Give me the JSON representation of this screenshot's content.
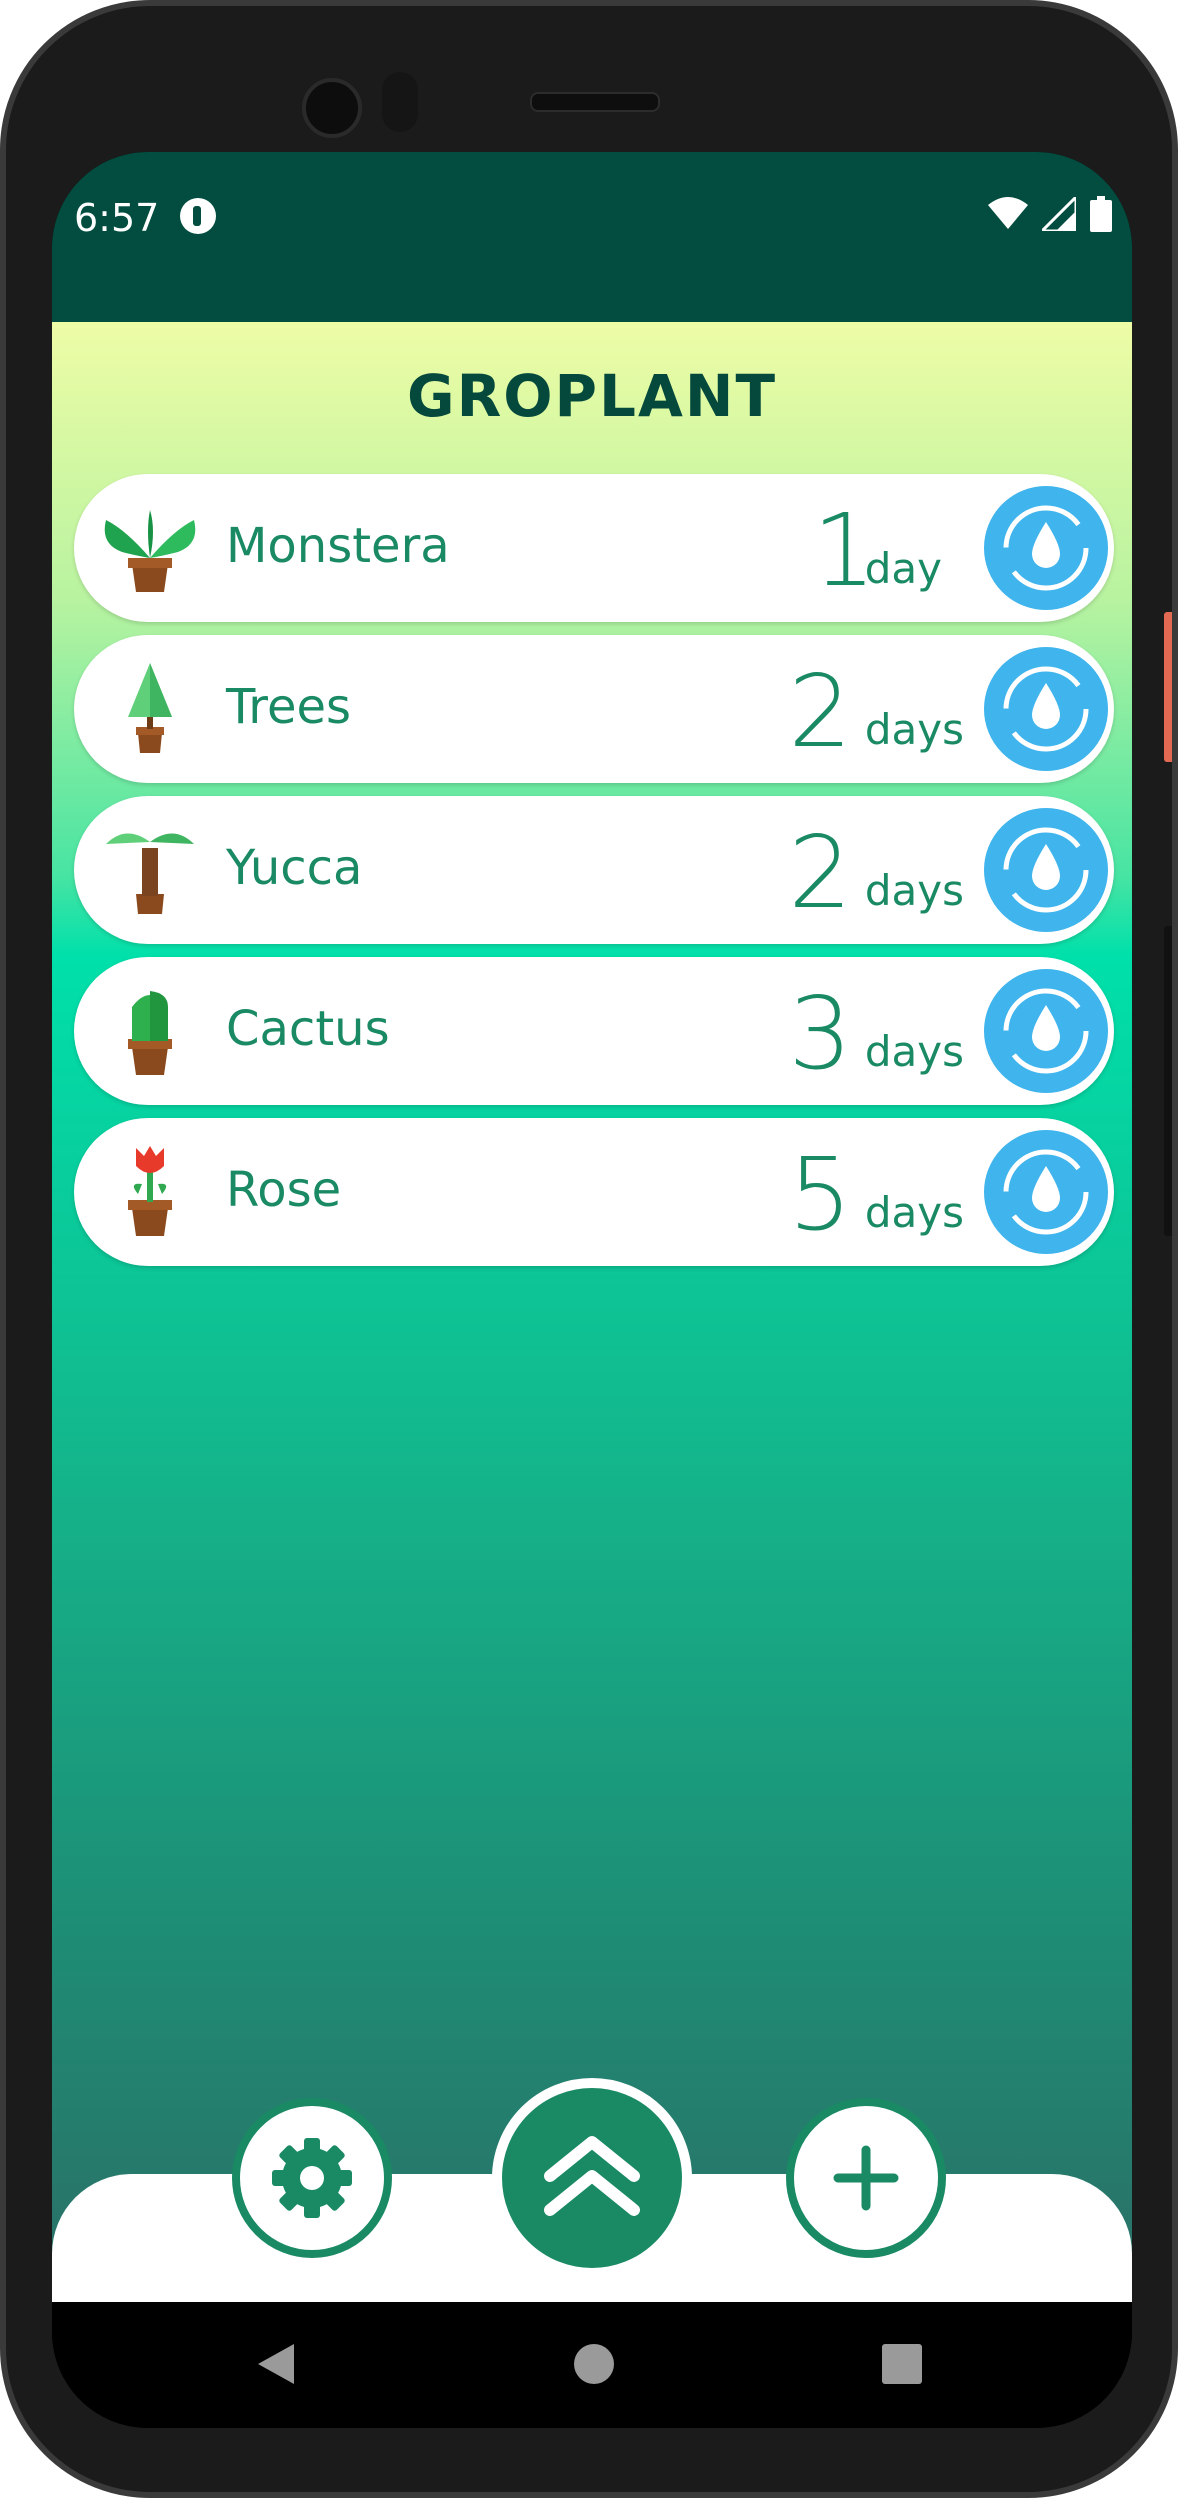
{
  "status_bar": {
    "time": "6:57"
  },
  "app": {
    "title": "GROPLANT",
    "plants": [
      {
        "name": "Monstera",
        "count": "1",
        "unit": "day",
        "icon": "monstera-icon"
      },
      {
        "name": "Trees",
        "count": "2",
        "unit": "days",
        "icon": "tree-icon"
      },
      {
        "name": "Yucca",
        "count": "2",
        "unit": "days",
        "icon": "yucca-icon"
      },
      {
        "name": "Cactus",
        "count": "3",
        "unit": "days",
        "icon": "cactus-icon"
      },
      {
        "name": "Rose",
        "count": "5",
        "unit": "days",
        "icon": "rose-icon"
      }
    ],
    "bottom_bar": {
      "settings_icon": "gear-icon",
      "center_icon": "double-chevron-up-icon",
      "add_icon": "plus-icon"
    }
  },
  "colors": {
    "status_bar": "#024d40",
    "accent": "#198a63",
    "water_button": "#3fb4ed",
    "title": "#05493d"
  }
}
